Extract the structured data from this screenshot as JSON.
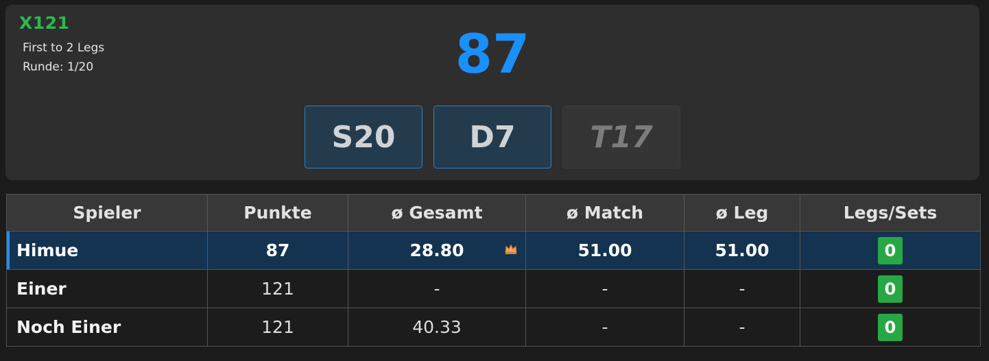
{
  "header": {
    "mode": "X121",
    "format": "First to 2 Legs",
    "round": "Runde: 1/20",
    "current_score": "87",
    "darts": [
      {
        "label": "S20",
        "state": "thrown"
      },
      {
        "label": "D7",
        "state": "thrown"
      },
      {
        "label": "T17",
        "state": "pending"
      }
    ]
  },
  "table": {
    "columns": [
      "Spieler",
      "Punkte",
      "ø Gesamt",
      "ø Match",
      "ø Leg",
      "Legs/Sets"
    ],
    "rows": [
      {
        "player": "Himue",
        "points": "87",
        "avg_total": "28.80",
        "avg_match": "51.00",
        "avg_leg": "51.00",
        "legs": "0",
        "active": true,
        "badge_icon": "crown-icon"
      },
      {
        "player": "Einer",
        "points": "121",
        "avg_total": "-",
        "avg_match": "-",
        "avg_leg": "-",
        "legs": "0",
        "active": false
      },
      {
        "player": "Noch Einer",
        "points": "121",
        "avg_total": "40.33",
        "avg_match": "-",
        "avg_leg": "-",
        "legs": "0",
        "active": false
      }
    ]
  },
  "colors": {
    "accent_blue": "#1a90ff",
    "mode_green": "#2eb84f",
    "badge_green": "#28a745",
    "active_row": "#143350"
  }
}
